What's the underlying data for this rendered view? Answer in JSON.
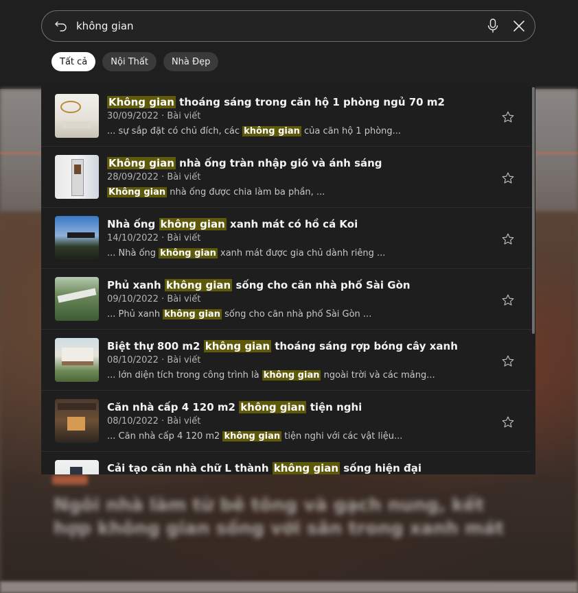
{
  "search": {
    "query": "không gian",
    "back_icon": "back-arrow-icon",
    "mic_icon": "microphone-icon",
    "clear_icon": "close-icon"
  },
  "filters": [
    {
      "label": "Tất cả",
      "active": true
    },
    {
      "label": "Nội Thất",
      "active": false
    },
    {
      "label": "Nhà Đẹp",
      "active": false
    }
  ],
  "results": [
    {
      "title_parts": [
        "",
        "Không gian",
        " thoáng sáng trong căn hộ 1 phòng ngủ 70 m2"
      ],
      "date": "30/09/2022",
      "type": "Bài viết",
      "snippet_parts": [
        "... sự sắp đặt có chủ đích, các ",
        "không gian",
        " của căn hộ 1 phòng..."
      ]
    },
    {
      "title_parts": [
        "",
        "Không gian",
        " nhà ống tràn nhập gió và ánh sáng"
      ],
      "date": "28/09/2022",
      "type": "Bài viết",
      "snippet_parts": [
        "",
        "Không gian",
        " nhà ống được chia làm ba phần, ..."
      ]
    },
    {
      "title_parts": [
        "Nhà ống ",
        "không gian",
        " xanh mát có hồ cá Koi"
      ],
      "date": "14/10/2022",
      "type": "Bài viết",
      "snippet_parts": [
        "... Nhà ống ",
        "không gian",
        " xanh mát được gia chủ dành riêng ..."
      ]
    },
    {
      "title_parts": [
        "Phủ xanh ",
        "không gian",
        " sống cho căn nhà phố Sài Gòn"
      ],
      "date": "09/10/2022",
      "type": "Bài viết",
      "snippet_parts": [
        "... Phủ xanh ",
        "không gian",
        " sống cho căn nhà phố Sài Gòn ..."
      ]
    },
    {
      "title_parts": [
        "Biệt thự 800 m2 ",
        "không gian",
        " thoáng sáng rợp bóng cây xanh"
      ],
      "date": "08/10/2022",
      "type": "Bài viết",
      "snippet_parts": [
        "... lớn diện tích trong công trình là ",
        "không gian",
        " ngoài trời và các mảng..."
      ]
    },
    {
      "title_parts": [
        "Căn nhà cấp 4 120 m2 ",
        "không gian",
        " tiện nghi"
      ],
      "date": "08/10/2022",
      "type": "Bài viết",
      "snippet_parts": [
        "... Căn nhà cấp 4 120 m2 ",
        "không gian",
        " tiện nghi với các vật liệu..."
      ]
    },
    {
      "title_parts": [
        "Cải tạo căn nhà chữ L thành ",
        "không gian",
        " sống hiện đại"
      ],
      "date": "",
      "type": "",
      "snippet_parts": [
        "",
        "",
        ""
      ]
    }
  ],
  "meta_separator": " · ",
  "star_icon": "star-outline-icon",
  "background_headline": "Ngôi nhà làm từ bê tông và gạch nung, kết hợp không gian sống với sân trong xanh mát",
  "colors": {
    "highlight": "#5f5a09",
    "panel": "#1e1e1e",
    "chip_active": "#ffffff",
    "chip": "#3a3a3a"
  }
}
